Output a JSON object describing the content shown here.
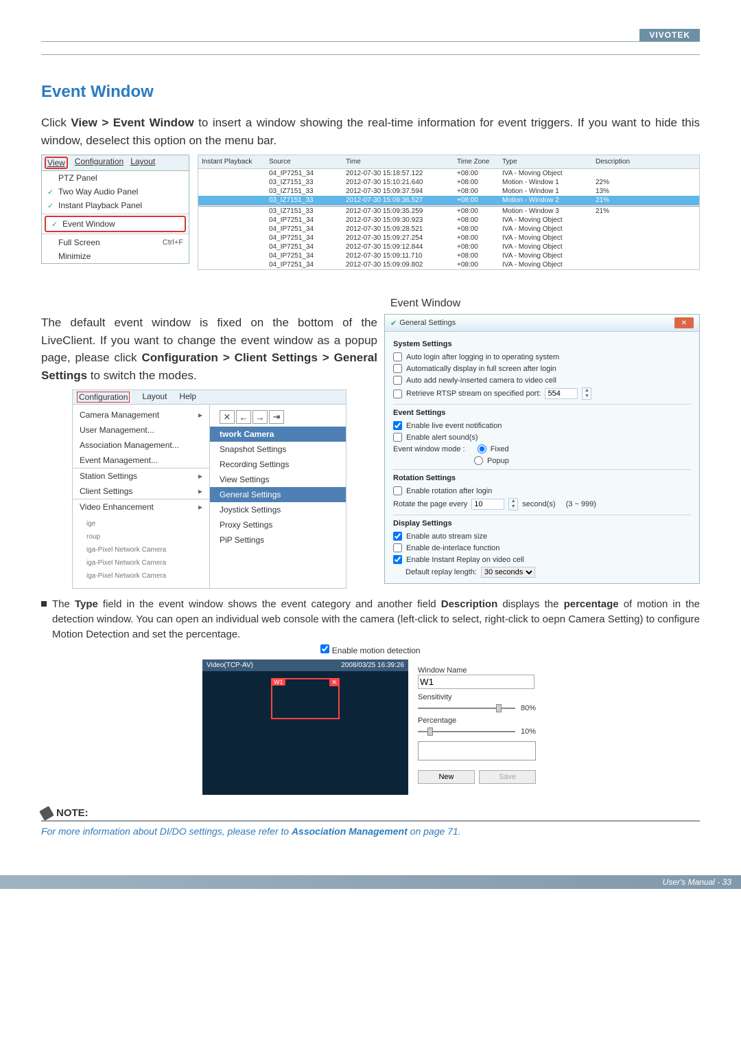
{
  "brand": "VIVOTEK",
  "heading": "Event Window",
  "intro": "Click View > Event Window to insert a window showing the real-time information for event triggers. If you want to hide this window, deselect this option on the menu bar.",
  "viewMenu": {
    "bar": [
      "View",
      "Configuration",
      "Layout"
    ],
    "items": [
      {
        "check": false,
        "label": "PTZ Panel"
      },
      {
        "check": true,
        "label": "Two Way Audio Panel"
      },
      {
        "check": true,
        "label": "Instant Playback Panel"
      },
      {
        "check": true,
        "label": "Event Window",
        "highlight": true
      },
      {
        "check": false,
        "label": "Full Screen",
        "accel": "Ctrl+F"
      },
      {
        "check": false,
        "label": "Minimize"
      }
    ]
  },
  "eventTable": {
    "headers": [
      "Instant Playback",
      "Source",
      "Time",
      "Time Zone",
      "Type",
      "Description"
    ],
    "rows": [
      {
        "src": "04_IP7251_34",
        "time": "2012-07-30 15:18:57.122",
        "tz": "+08:00",
        "type": "IVA - Moving Object",
        "desc": ""
      },
      {
        "src": "03_IZ7151_33",
        "time": "2012-07-30 15:10:21.640",
        "tz": "+08:00",
        "type": "Motion - Window 1",
        "desc": "22%"
      },
      {
        "src": "03_IZ7151_33",
        "time": "2012-07-30 15:09:37.594",
        "tz": "+08:00",
        "type": "Motion - Window 1",
        "desc": "13%"
      },
      {
        "src": "03_IZ7151_33",
        "time": "2012-07-30 15:09:36.527",
        "tz": "+08:00",
        "type": "Motion - Window 2",
        "desc": "21%",
        "sel": true
      },
      {
        "src": "03_IZ7151_33",
        "time": "2012-07-30 15:09:35.259",
        "tz": "+08:00",
        "type": "Motion - Window 3",
        "desc": "21%",
        "group": true
      },
      {
        "src": "04_IP7251_34",
        "time": "2012-07-30 15:09:30.923",
        "tz": "+08:00",
        "type": "IVA - Moving Object",
        "desc": ""
      },
      {
        "src": "04_IP7251_34",
        "time": "2012-07-30 15:09:28.521",
        "tz": "+08:00",
        "type": "IVA - Moving Object",
        "desc": ""
      },
      {
        "src": "04_IP7251_34",
        "time": "2012-07-30 15:09:27.254",
        "tz": "+08:00",
        "type": "IVA - Moving Object",
        "desc": ""
      },
      {
        "src": "04_IP7251_34",
        "time": "2012-07-30 15:09:12.844",
        "tz": "+08:00",
        "type": "IVA - Moving Object",
        "desc": ""
      },
      {
        "src": "04_IP7251_34",
        "time": "2012-07-30 15:09:11.710",
        "tz": "+08:00",
        "type": "IVA - Moving Object",
        "desc": ""
      },
      {
        "src": "04_IP7251_34",
        "time": "2012-07-30 15:09:09.802",
        "tz": "+08:00",
        "type": "IVA - Moving Object",
        "desc": ""
      }
    ]
  },
  "fig1Label": "Event Window",
  "para2": "The default event window is fixed on the bottom of the LiveClient. If you want to change the event window as a popup page, please click Configuration > Client Settings > General Settings to switch the modes.",
  "confMenu": {
    "bar": [
      "Configuration",
      "Layout",
      "Help"
    ],
    "left": [
      "Camera Management",
      "User Management...",
      "Association Management...",
      "Event Management...",
      "Station Settings",
      "Client Settings",
      "Video Enhancement"
    ],
    "sideList": [
      "ige",
      "roup",
      "iga-Pixel Network Camera",
      "iga-Pixel Network Camera",
      "iga-Pixel Network Camera"
    ],
    "camTitle": "twork Camera",
    "right": [
      "Snapshot Settings",
      "Recording Settings",
      "View Settings",
      "General Settings",
      "Joystick Settings",
      "Proxy Settings",
      "PiP Settings"
    ],
    "tbIcons": [
      "⨯",
      "←",
      "→",
      "⇥"
    ]
  },
  "gs": {
    "title": "General Settings",
    "sys": {
      "hdr": "System Settings",
      "o1": "Auto login after logging in to operating system",
      "o2": "Automatically display in full screen after login",
      "o3": "Auto add newly-inserted camera to video cell",
      "o4": "Retrieve RTSP stream on specified port:",
      "port": "554"
    },
    "evt": {
      "hdr": "Event Settings",
      "o1": "Enable live event notification",
      "o2": "Enable alert sound(s)",
      "modeLabel": "Event window mode :",
      "m1": "Fixed",
      "m2": "Popup"
    },
    "rot": {
      "hdr": "Rotation Settings",
      "o1": "Enable rotation after login",
      "rowLabel": "Rotate the page every",
      "val": "10",
      "unit": "second(s)",
      "range": "(3 ~ 999)"
    },
    "disp": {
      "hdr": "Display Settings",
      "o1": "Enable auto stream size",
      "o2": "Enable de-interlace function",
      "o3": "Enable Instant Replay on video cell",
      "replayLabel": "Default replay length:",
      "replayVal": "30 seconds"
    }
  },
  "bullet": "The Type field in the event window shows the event category and another field Description displays the percentage of motion in the detection window. You can open an individual web console with the camera (left-click to select, right-click to oepn Camera Setting) to configure Motion Detection and set the percentage.",
  "enableMD": "Enable motion detection",
  "md": {
    "topLeft": "Video(TCP-AV)",
    "topRight": "2008/03/25 16:39:26",
    "winbox": "W1",
    "x": "✕",
    "wnLabel": "Window Name",
    "wn": "W1",
    "sensLabel": "Sensitivity",
    "sens": "80%",
    "percLabel": "Percentage",
    "perc": "10%",
    "btnNew": "New",
    "btnSave": "Save"
  },
  "note": {
    "hdr": "NOTE:",
    "text": "For more information about DI/DO settings, please refer to Association Management on page 71."
  },
  "footer": "User's Manual - 33"
}
